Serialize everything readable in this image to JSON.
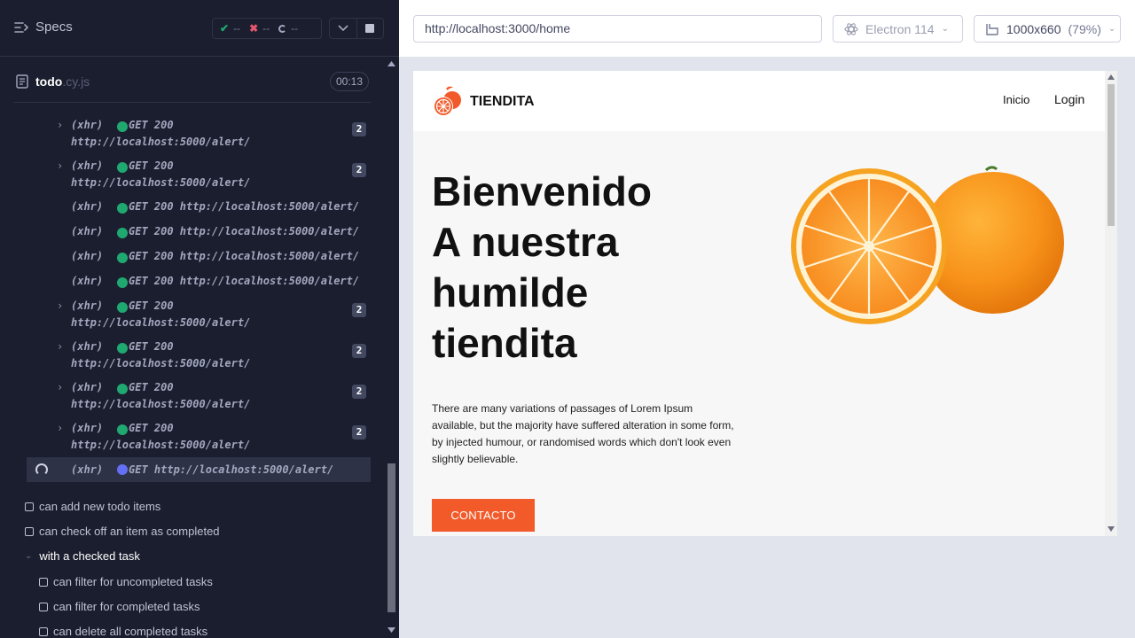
{
  "runner": {
    "specs_label": "Specs",
    "stats": {
      "passed": "--",
      "failed": "--",
      "pending": "--"
    },
    "spec": {
      "name": "todo",
      "ext": ".cy.js",
      "timer": "00:13"
    },
    "logs": [
      {
        "kind": "xhr",
        "tag": "(xhr)",
        "method": "GET 200",
        "url": "http://localhost:5000/alert/",
        "count": "2",
        "wrapped": true
      },
      {
        "kind": "xhr",
        "tag": "(xhr)",
        "method": "GET 200",
        "url": "http://localhost:5000/alert/",
        "count": "2",
        "wrapped": true
      },
      {
        "kind": "xhr",
        "tag": "(xhr)",
        "method": "GET 200 http://localhost:5000/alert/"
      },
      {
        "kind": "xhr",
        "tag": "(xhr)",
        "method": "GET 200 http://localhost:5000/alert/"
      },
      {
        "kind": "xhr",
        "tag": "(xhr)",
        "method": "GET 200 http://localhost:5000/alert/"
      },
      {
        "kind": "xhr",
        "tag": "(xhr)",
        "method": "GET 200 http://localhost:5000/alert/"
      },
      {
        "kind": "xhr",
        "tag": "(xhr)",
        "method": "GET 200",
        "url": "http://localhost:5000/alert/",
        "count": "2",
        "wrapped": true
      },
      {
        "kind": "xhr",
        "tag": "(xhr)",
        "method": "GET 200",
        "url": "http://localhost:5000/alert/",
        "count": "2",
        "wrapped": true
      },
      {
        "kind": "xhr",
        "tag": "(xhr)",
        "method": "GET 200",
        "url": "http://localhost:5000/alert/",
        "count": "2",
        "wrapped": true
      },
      {
        "kind": "xhr",
        "tag": "(xhr)",
        "method": "GET 200",
        "url": "http://localhost:5000/alert/",
        "count": "2",
        "wrapped": true
      },
      {
        "kind": "pending",
        "tag": "(xhr)",
        "method": "GET http://localhost:5000/alert/"
      }
    ],
    "tests": [
      {
        "label": "can add new todo items"
      },
      {
        "label": "can check off an item as completed"
      }
    ],
    "suite": {
      "label": "with a checked task",
      "tests": [
        {
          "label": "can filter for uncompleted tasks"
        },
        {
          "label": "can filter for completed tasks"
        },
        {
          "label": "can delete all completed tasks"
        }
      ]
    }
  },
  "aut": {
    "url": "http://localhost:3000/home",
    "browser": "Electron 114",
    "viewport": "1000x660",
    "zoom": "(79%)"
  },
  "site": {
    "logo_text": "TIENDITA",
    "nav": {
      "home": "Inicio",
      "login": "Login"
    },
    "hero_lines": [
      "Bienvenido",
      "A nuestra",
      "humilde",
      "tiendita"
    ],
    "hero_text": "There are many variations of passages of Lorem Ipsum available, but the majority have suffered alteration in some form, by injected humour, or randomised words which don't look even slightly believable.",
    "cta": "CONTACTO"
  },
  "colors": {
    "runner_bg": "#1b1e2e",
    "pass": "#1fa971",
    "fail": "#e45770",
    "pending_dot": "#6470f3",
    "cta": "#f25a2a"
  }
}
